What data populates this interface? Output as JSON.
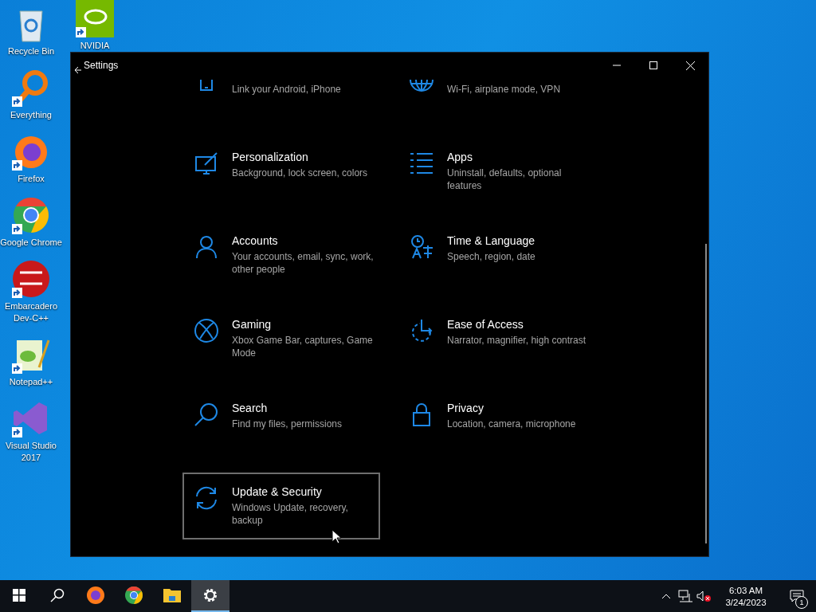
{
  "desktop": {
    "icons": [
      {
        "label": "Recycle Bin",
        "kind": "recycle",
        "shortcut": false
      },
      {
        "label": "Everything",
        "kind": "everything",
        "shortcut": true
      },
      {
        "label": "Firefox",
        "kind": "firefox",
        "shortcut": true
      },
      {
        "label": "Google Chrome",
        "kind": "chrome",
        "shortcut": true
      },
      {
        "label": "Embarcadero Dev-C++",
        "kind": "devcpp",
        "shortcut": true
      },
      {
        "label": "Notepad++",
        "kind": "notepad",
        "shortcut": true
      },
      {
        "label": "Visual Studio 2017",
        "kind": "vs",
        "shortcut": true
      }
    ],
    "second_column": [
      {
        "label": "NVIDIA",
        "kind": "nvidia",
        "shortcut": true
      }
    ]
  },
  "window": {
    "title": "Settings"
  },
  "settings": [
    {
      "kind": "phone",
      "description": "Link your Android, iPhone",
      "selected": false
    },
    {
      "kind": "globe",
      "description": "Wi-Fi, airplane mode, VPN",
      "selected": false
    },
    {
      "kind": "brush",
      "title": "Personalization",
      "description": "Background, lock screen, colors",
      "selected": false
    },
    {
      "kind": "apps",
      "title": "Apps",
      "description": "Uninstall, defaults, optional features",
      "selected": false
    },
    {
      "kind": "person",
      "title": "Accounts",
      "description": "Your accounts, email, sync, work, other people",
      "selected": false
    },
    {
      "kind": "time",
      "title": "Time & Language",
      "description": "Speech, region, date",
      "selected": false
    },
    {
      "kind": "xbox",
      "title": "Gaming",
      "description": "Xbox Game Bar, captures, Game Mode",
      "selected": false
    },
    {
      "kind": "ease",
      "title": "Ease of Access",
      "description": "Narrator, magnifier, high contrast",
      "selected": false
    },
    {
      "kind": "search",
      "title": "Search",
      "description": "Find my files, permissions",
      "selected": false
    },
    {
      "kind": "lock",
      "title": "Privacy",
      "description": "Location, camera, microphone",
      "selected": false
    },
    {
      "kind": "update",
      "title": "Update & Security",
      "description": "Windows Update, recovery, backup",
      "selected": true
    }
  ],
  "taskbar": {
    "apps": [
      {
        "kind": "start",
        "selected": false
      },
      {
        "kind": "search",
        "selected": false
      },
      {
        "kind": "firefox",
        "selected": false
      },
      {
        "kind": "chrome",
        "selected": false
      },
      {
        "kind": "explorer",
        "selected": false
      },
      {
        "kind": "settings",
        "selected": true
      }
    ],
    "tray": {
      "time": "6:03 AM",
      "date": "3/24/2023",
      "notifications": "1"
    }
  }
}
